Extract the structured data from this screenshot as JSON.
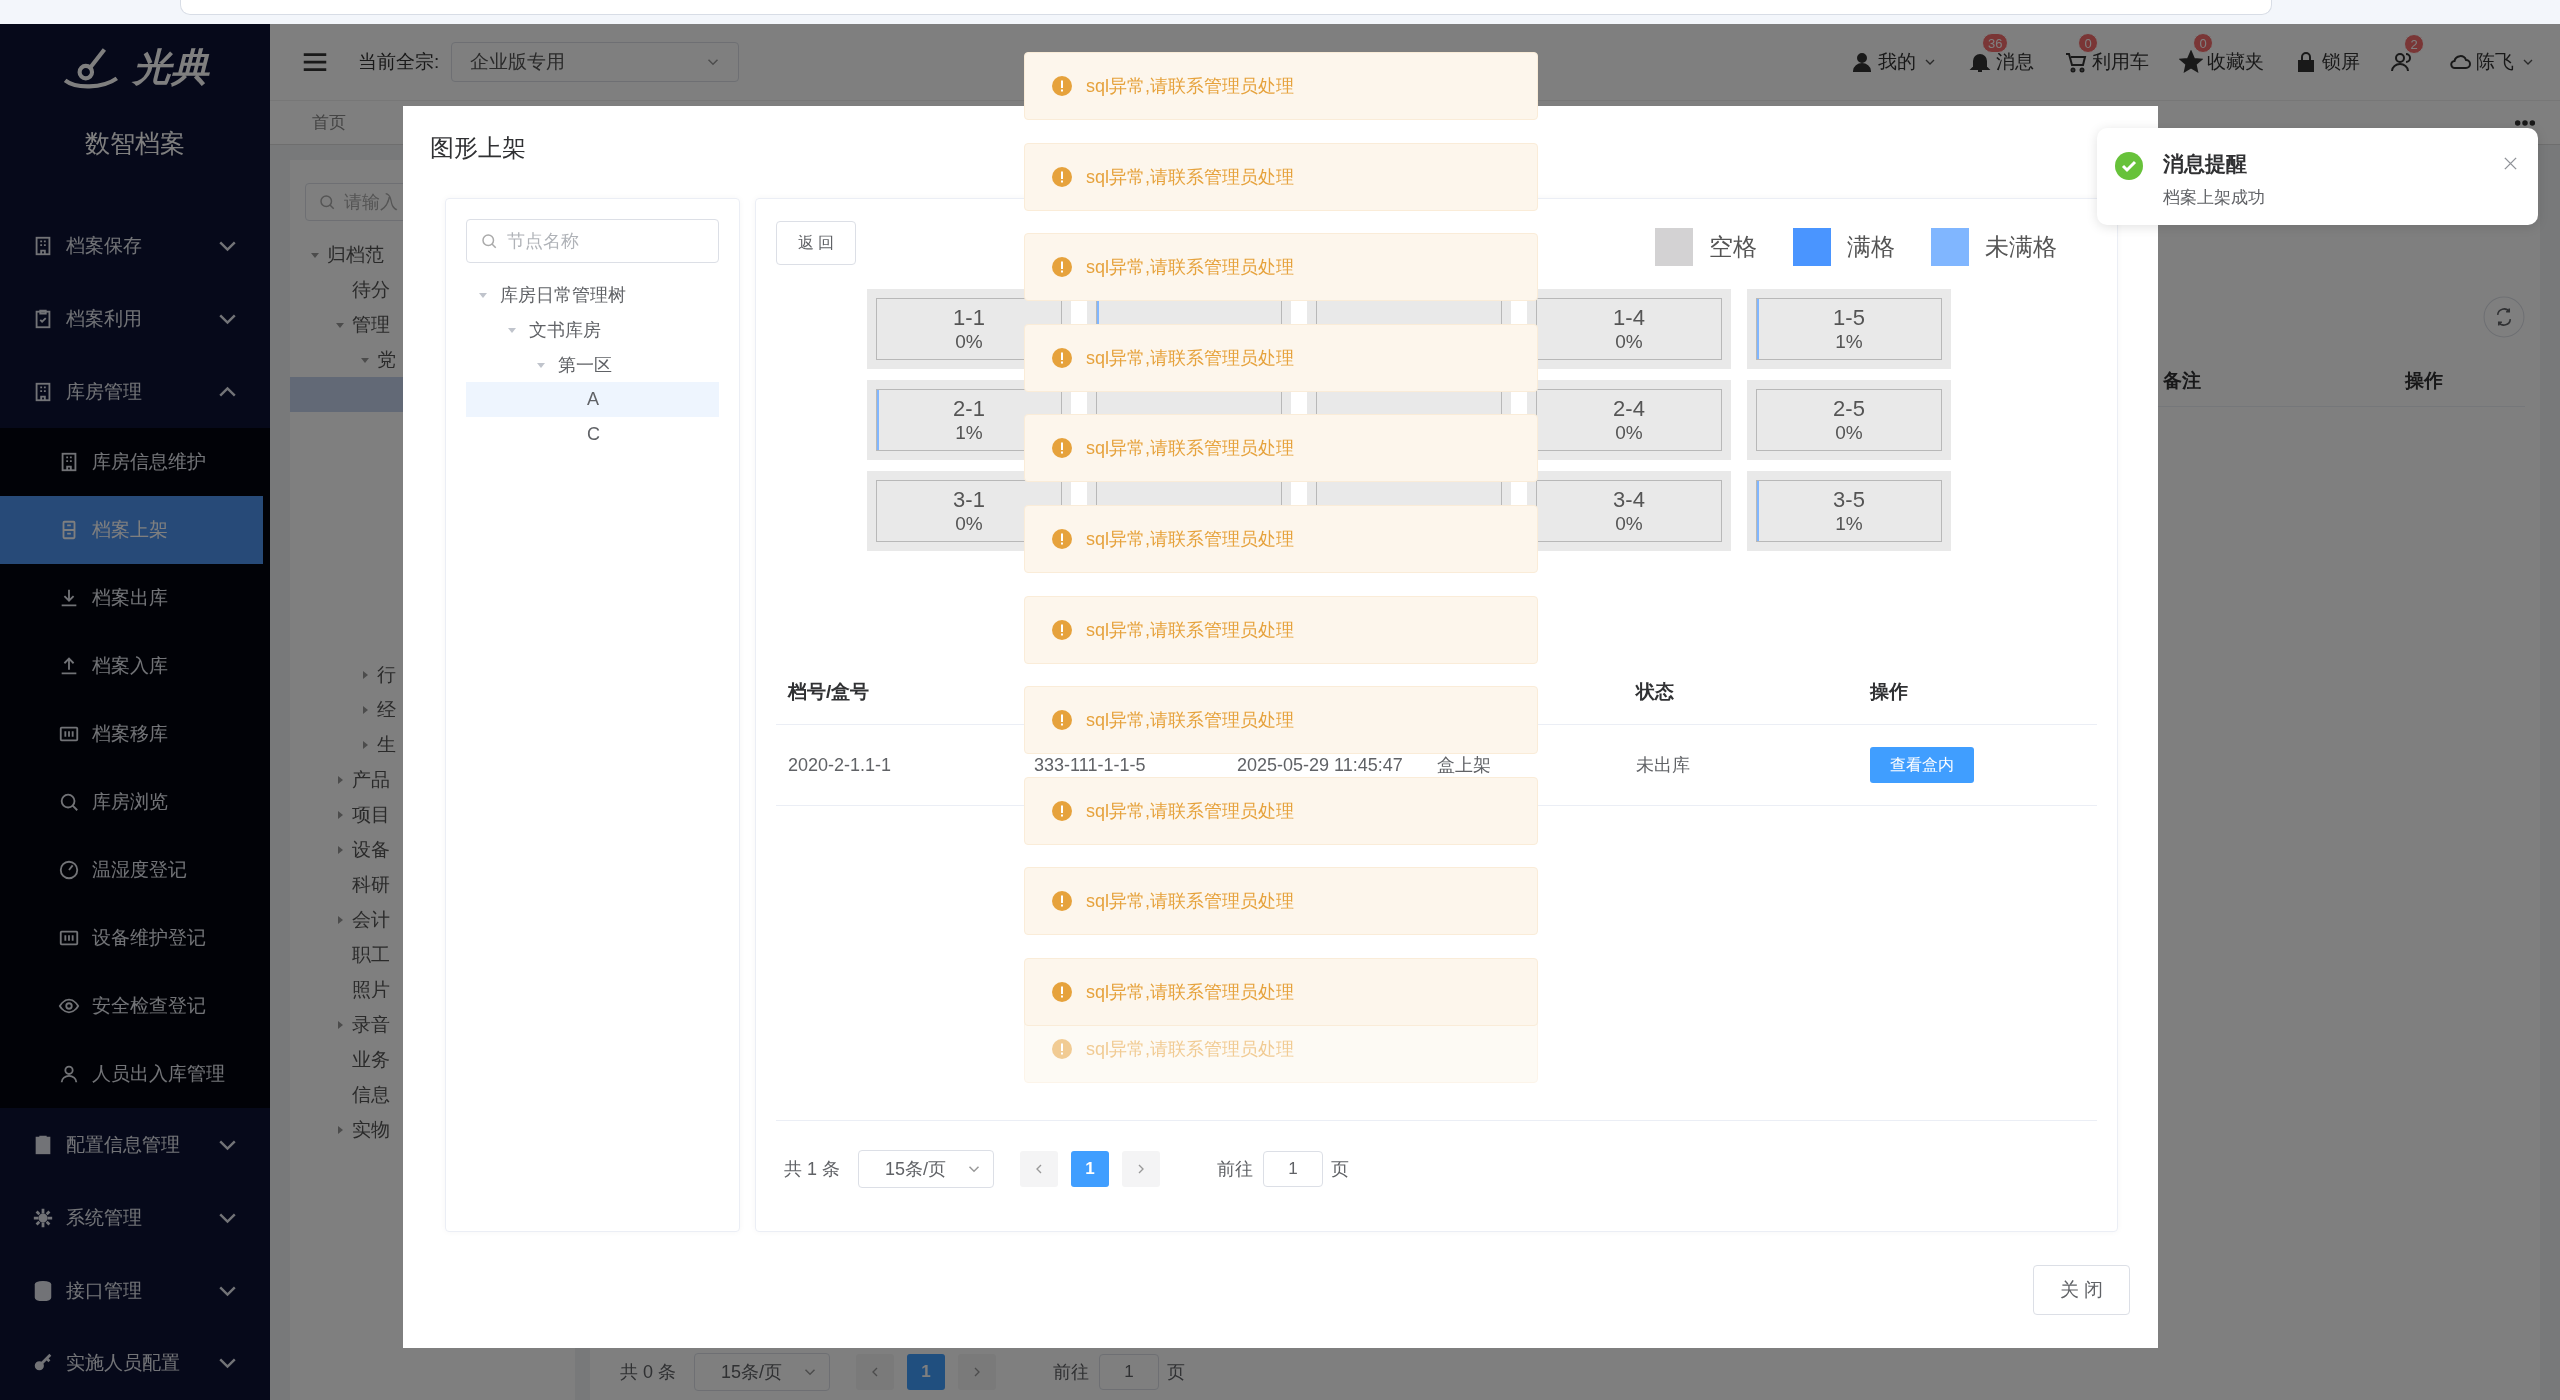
{
  "sidebar": {
    "logo": "光典",
    "title": "数智档案",
    "menu": [
      {
        "label": "档案保存",
        "expanded": false
      },
      {
        "label": "档案利用",
        "expanded": false
      },
      {
        "label": "库房管理",
        "expanded": true,
        "children": [
          {
            "label": "库房信息维护",
            "selected": false
          },
          {
            "label": "档案上架",
            "selected": true
          },
          {
            "label": "档案出库",
            "selected": false
          },
          {
            "label": "档案入库",
            "selected": false
          },
          {
            "label": "档案移库",
            "selected": false
          },
          {
            "label": "库房浏览",
            "selected": false
          },
          {
            "label": "温湿度登记",
            "selected": false
          },
          {
            "label": "设备维护登记",
            "selected": false
          },
          {
            "label": "安全检查登记",
            "selected": false
          },
          {
            "label": "人员出入库管理",
            "selected": false
          }
        ]
      },
      {
        "label": "配置信息管理",
        "expanded": false
      },
      {
        "label": "系统管理",
        "expanded": false
      },
      {
        "label": "接口管理",
        "expanded": false
      },
      {
        "label": "实施人员配置",
        "expanded": false
      }
    ]
  },
  "header": {
    "fonds_label": "当前全宗:",
    "fonds_value": "企业版专用",
    "actions": [
      {
        "kind": "menu",
        "label": "我的"
      },
      {
        "kind": "badge",
        "label": "消息",
        "badge": "36"
      },
      {
        "kind": "badge",
        "label": "利用车",
        "badge": "0"
      },
      {
        "kind": "badge",
        "label": "收藏夹",
        "badge": "0"
      },
      {
        "kind": "plain",
        "label": "锁屏"
      },
      {
        "kind": "badge",
        "badge": "2"
      },
      {
        "kind": "menu",
        "label": "陈飞"
      }
    ]
  },
  "tabs": [
    {
      "label": "首页"
    }
  ],
  "background": {
    "tree": {
      "placeholder": "请输入",
      "items": [
        {
          "label": "归档范",
          "expanded": true,
          "children": [
            {
              "label": "待分"
            },
            {
              "label": "管理",
              "expanded": true,
              "children": [
                {
                  "label": "党",
                  "expanded": true,
                  "children": [
                    {
                      "selected": true
                    },
                    {
                      "selected": false
                    },
                    {
                      "selected": false
                    },
                    {
                      "selected": false
                    },
                    {
                      "selected": false
                    },
                    {
                      "selected": false
                    },
                    {
                      "selected": false
                    },
                    {
                      "selected": false
                    }
                  ]
                },
                {
                  "label": "行",
                  "expanded": false
                },
                {
                  "label": "经",
                  "expanded": false
                },
                {
                  "label": "生",
                  "expanded": false
                }
              ]
            },
            {
              "label": "产品",
              "expanded": false
            },
            {
              "label": "项目",
              "expanded": false
            },
            {
              "label": "设备",
              "expanded": false
            },
            {
              "label": "科研"
            },
            {
              "label": "会计",
              "expanded": false
            },
            {
              "label": "职工"
            },
            {
              "label": "照片"
            },
            {
              "label": "录音",
              "expanded": false
            },
            {
              "label": "业务"
            },
            {
              "label": "信息"
            },
            {
              "label": "实物",
              "expanded": false
            }
          ]
        }
      ]
    },
    "table_columns": [
      "备注",
      "操作"
    ],
    "pagination": {
      "total": "共 0 条",
      "page_size": "15条/页",
      "pages": [
        {
          "label": "1",
          "selected": true
        }
      ],
      "goto_label": "前往",
      "goto_value": "1",
      "page_suffix": "页"
    }
  },
  "dialog": {
    "title": "图形上架",
    "tree": {
      "placeholder": "节点名称",
      "items": [
        {
          "label": "库房日常管理树",
          "expanded": true,
          "children": [
            {
              "label": "文书库房",
              "expanded": true,
              "children": [
                {
                  "label": "第一区",
                  "expanded": true,
                  "children": [
                    {
                      "label": "A",
                      "selected": true
                    },
                    {
                      "label": "C",
                      "selected": false
                    }
                  ]
                }
              ]
            }
          ]
        }
      ]
    },
    "back_button": "返 回",
    "legend": [
      {
        "label": "空格",
        "color": "#d3d2d3"
      },
      {
        "label": "满格",
        "color": "#4a95ff"
      },
      {
        "label": "未满格",
        "color": "#80b6ff"
      }
    ],
    "grid": [
      {
        "cells": [
          {
            "label": "1-1",
            "reading": "0%"
          },
          {
            "level": 0.01
          },
          {},
          {
            "label": "1-4",
            "reading": "0%"
          },
          {
            "label": "1-5",
            "reading": "1%",
            "level": 0.01
          }
        ]
      },
      {
        "cells": [
          {
            "label": "2-1",
            "reading": "1%",
            "level": 0.01
          },
          {},
          {},
          {
            "label": "2-4",
            "reading": "0%"
          },
          {
            "label": "2-5",
            "reading": "0%"
          }
        ]
      },
      {
        "cells": [
          {
            "label": "3-1",
            "reading": "0%"
          },
          {},
          {},
          {
            "label": "3-4",
            "reading": "0%"
          },
          {
            "label": "3-5",
            "reading": "1%",
            "level": 0.01
          }
        ]
      }
    ],
    "table": {
      "columns": [
        {
          "label": "档号/盒号"
        },
        {},
        {},
        {},
        {
          "label": "状态"
        },
        {
          "label": "操作"
        }
      ],
      "rows": [
        {
          "cells": [
            "2020-2-1.1-1",
            "333-111-1-1-5",
            "2025-05-29 11:45:47",
            "盒上架",
            "未出库"
          ],
          "action": "查看盒内"
        }
      ]
    },
    "pagination": {
      "total": "共 1 条",
      "page_size": "15条/页",
      "pages": [
        {
          "label": "1",
          "selected": true
        }
      ],
      "goto_label": "前往",
      "goto_value": "1",
      "page_suffix": "页"
    },
    "close_button": "关 闭"
  },
  "toasts": [
    {
      "text": "sql异常,请联系管理员处理",
      "faded": false
    },
    {
      "text": "sql异常,请联系管理员处理",
      "faded": false
    },
    {
      "text": "sql异常,请联系管理员处理",
      "faded": false
    },
    {
      "text": "sql异常,请联系管理员处理",
      "faded": false
    },
    {
      "text": "sql异常,请联系管理员处理",
      "faded": false
    },
    {
      "text": "sql异常,请联系管理员处理",
      "faded": false
    },
    {
      "text": "sql异常,请联系管理员处理",
      "faded": false
    },
    {
      "text": "sql异常,请联系管理员处理",
      "faded": false
    },
    {
      "text": "sql异常,请联系管理员处理",
      "faded": false
    },
    {
      "text": "sql异常,请联系管理员处理",
      "faded": false
    },
    {
      "text": "sql异常,请联系管理员处理",
      "faded": false
    },
    {
      "text": "sql异常,请联系管理员处理",
      "faded": true
    }
  ],
  "notification": {
    "title": "消息提醒",
    "message": "档案上架成功"
  }
}
